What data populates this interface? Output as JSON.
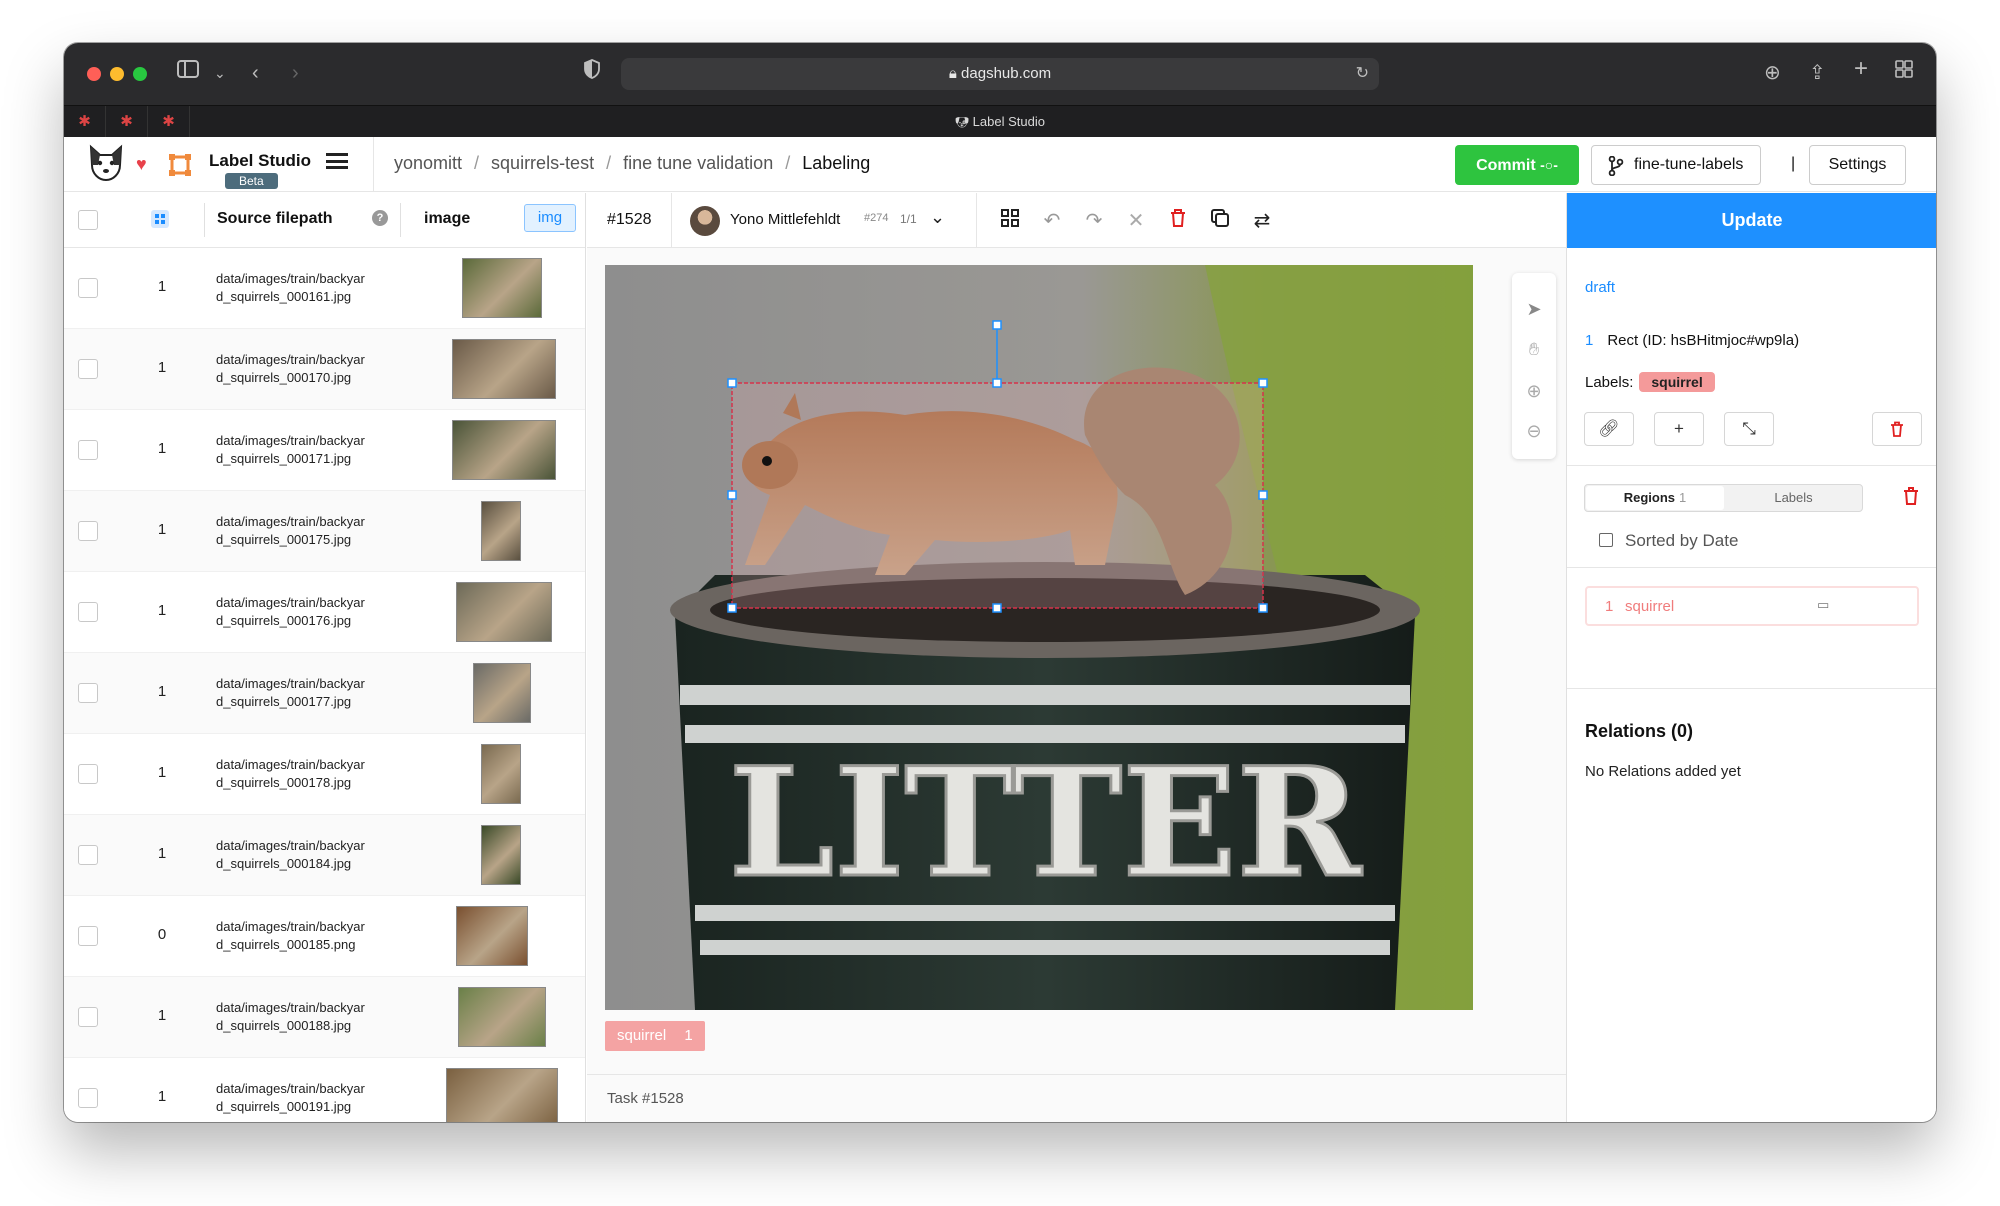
{
  "browser": {
    "url": "dagshub.com",
    "tab_title": "Label Studio"
  },
  "header": {
    "brand": "Label Studio",
    "beta": "Beta",
    "breadcrumbs": [
      "yonomitt",
      "squirrels-test",
      "fine tune validation",
      "Labeling"
    ],
    "commit_label": "Commit",
    "branch_label": "fine-tune-labels",
    "separator": "|",
    "settings_label": "Settings"
  },
  "table": {
    "columns": {
      "source": "Source filepath",
      "image": "image",
      "image_tag": "img"
    },
    "rows": [
      {
        "count": "1",
        "path_l1": "data/images/train/backyar",
        "path_l2": "d_squirrels_000161.jpg"
      },
      {
        "count": "1",
        "path_l1": "data/images/train/backyar",
        "path_l2": "d_squirrels_000170.jpg"
      },
      {
        "count": "1",
        "path_l1": "data/images/train/backyar",
        "path_l2": "d_squirrels_000171.jpg"
      },
      {
        "count": "1",
        "path_l1": "data/images/train/backyar",
        "path_l2": "d_squirrels_000175.jpg"
      },
      {
        "count": "1",
        "path_l1": "data/images/train/backyar",
        "path_l2": "d_squirrels_000176.jpg"
      },
      {
        "count": "1",
        "path_l1": "data/images/train/backyar",
        "path_l2": "d_squirrels_000177.jpg"
      },
      {
        "count": "1",
        "path_l1": "data/images/train/backyar",
        "path_l2": "d_squirrels_000178.jpg"
      },
      {
        "count": "1",
        "path_l1": "data/images/train/backyar",
        "path_l2": "d_squirrels_000184.jpg"
      },
      {
        "count": "0",
        "path_l1": "data/images/train/backyar",
        "path_l2": "d_squirrels_000185.png"
      },
      {
        "count": "1",
        "path_l1": "data/images/train/backyar",
        "path_l2": "d_squirrels_000188.jpg"
      },
      {
        "count": "1",
        "path_l1": "data/images/train/backyar",
        "path_l2": "d_squirrels_000191.jpg"
      }
    ]
  },
  "editor": {
    "task_id": "#1528",
    "annotator_name": "Yono Mittlefehldt",
    "annotator_id": "#274",
    "annotation_page": "1/1",
    "image_text": "LITTER",
    "label_chip": "squirrel",
    "label_chip_count": "1",
    "footer": "Task #1528"
  },
  "panel": {
    "update_label": "Update",
    "status": "draft",
    "region_index": "1",
    "region_desc": "Rect (ID: hsBHitmjoc#wp9la)",
    "labels_prefix": "Labels:",
    "label_value": "squirrel",
    "tab_regions": "Regions",
    "tab_regions_count": "1",
    "tab_labels": "Labels",
    "sorted_by": "Sorted by Date",
    "region_item_index": "1",
    "region_item_label": "squirrel",
    "relations_title": "Relations (0)",
    "relations_empty": "No Relations added yet"
  },
  "colors": {
    "commit_green": "#2ec43f",
    "update_blue": "#1e90ff",
    "label_red": "#f49a9a",
    "bbox_stroke": "#d6324b",
    "link_blue": "#1a8cff"
  }
}
